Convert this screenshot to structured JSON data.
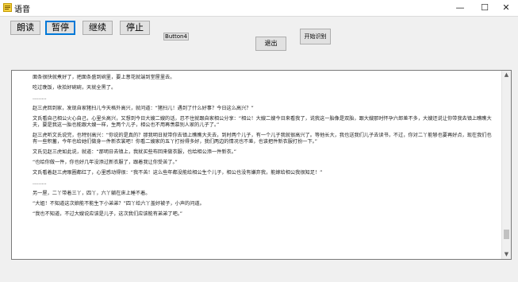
{
  "window": {
    "title": "语音",
    "controls": {
      "minimize": "—",
      "maximize": "☐",
      "close": "✕"
    }
  },
  "toolbar": {
    "read": "朗读",
    "pause": "暂停",
    "continue": "继续",
    "stop": "停止",
    "button4": "Button4",
    "exit": "退出",
    "start_recognition": "开始识别"
  },
  "text_content": [
    "面条很快就煮好了，把面条盛到碗里，要上葱花就端到堂屋里去。",
    "吃过晚饭，收拾好碗碗，天就全黑了。",
    ".........",
    "赵三虎回到家，发现自家猪扫儿今天格外高兴，就问道：“猪扫儿！遇到了什么好事？今日这么高兴？”",
    "文氏看自己相公火心自己，心里头高兴，又想到今日大嫂二嫂的话，忍不住就跟自家相公分享：“相公！大嫂二嫂今日来看我了，说我这一胎像是双胎，跟大嫂那时怀孕六郎差不多，大嫂还说让你带我去镇上瞧瞧大夫，要是我这一胎也能跟大嫂一样，生两个儿子，相公也不用再羡慕别人家的儿子了。”",
    "赵三虎听文氏说完，也特别高兴：“你说的是真的？那我明日就带你去镇上瞧瞧大夫去，到时两个儿子，有一个儿子我就很高兴了。等他长大，我也送我们儿子去读书，不过，你对二丫能够也要再好点，现在我们也有一些积蓄，今年也给她们做身一件新衣裳吧！你看二嫂家的五丫打扮得多好，我们两边的情况也不差，也该把件新衣服打扮一下。”",
    "文氏见赵三虎如此说，就道：“那明日去镇上，我就买些布回来做衣服，也给相公添一件新衣。”",
    "“也给你做一件，你也好几年没添过新衣服了，跟着我让你受苦了。”",
    "文氏看着赵三虎眼圈都红了，心里感动得很：“我不苦！这么些年都没能给相公生个儿子，相公也没有嫌弃我，能嫁给相公我很知足！”",
    ".........",
    "另一屋，二丫带着三丫，四丫，六丫躺在床上睡不着。",
    "“大姐！不知道这次娘能不能生下小弟弟？”四丫给六丫盖好被子，小声的问道。",
    "“我也不知道，不过大嫂说应该是儿子，这次我们应该能有弟弟了吧。”"
  ],
  "scrollbar": {
    "up": "▲",
    "down": "▼",
    "position": 0.93
  }
}
